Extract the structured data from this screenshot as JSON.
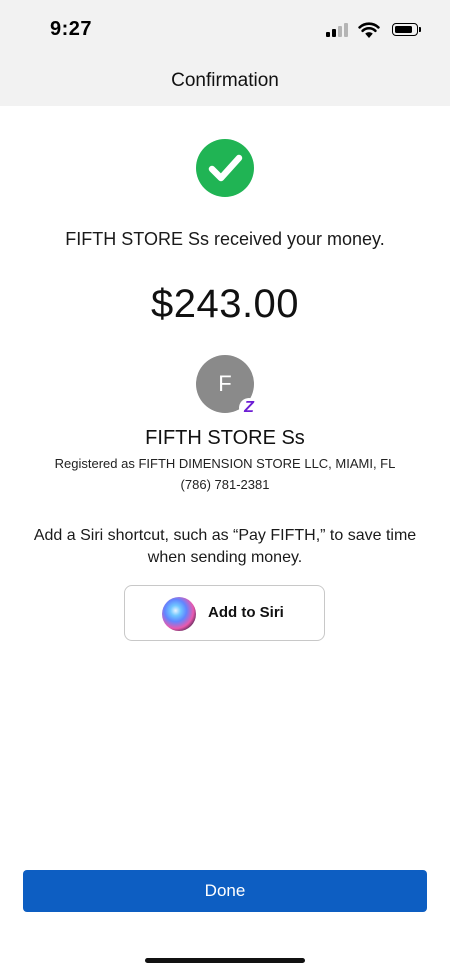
{
  "status_bar": {
    "time": "9:27",
    "signal_bars": 4,
    "signal_active_bars": 2
  },
  "nav": {
    "title": "Confirmation"
  },
  "confirmation": {
    "success_icon": "checkmark-circle-icon",
    "message": "FIFTH STORE Ss received your money.",
    "amount": "$243.00"
  },
  "recipient": {
    "avatar_initial": "F",
    "badge_icon": "zelle-icon",
    "badge_glyph": "Z",
    "name": "FIFTH STORE Ss",
    "registered_as": "Registered as FIFTH DIMENSION STORE LLC, MIAMI, FL",
    "phone": "(786) 781-2381"
  },
  "siri": {
    "hint": "Add a Siri shortcut, such as “Pay FIFTH,” to save time when sending money.",
    "button_label": "Add to Siri",
    "icon": "siri-icon"
  },
  "actions": {
    "done_label": "Done"
  },
  "colors": {
    "success": "#20b454",
    "primary": "#0d5ec2",
    "zelle": "#6d1ed4",
    "avatar": "#8a8a8a"
  }
}
